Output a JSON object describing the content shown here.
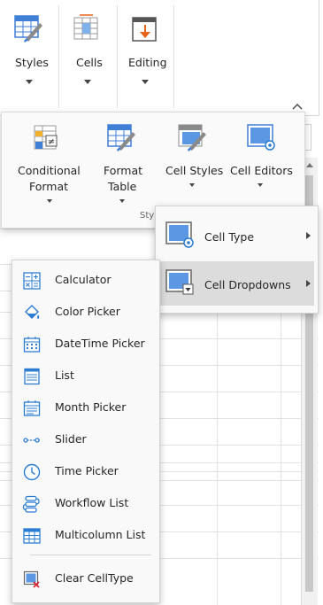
{
  "ribbon": {
    "groups": [
      {
        "label": "Styles",
        "icon": "styles-icon"
      },
      {
        "label": "Cells",
        "icon": "cells-icon"
      },
      {
        "label": "Editing",
        "icon": "editing-icon"
      }
    ],
    "collapse_icon": "chevron-up-icon"
  },
  "styles_popup": {
    "buttons": [
      {
        "line1": "Conditional",
        "line2": "Format",
        "icon": "conditional-format-icon"
      },
      {
        "line1": "Format",
        "line2": "Table",
        "icon": "format-table-icon"
      },
      {
        "line1": "Cell Styles",
        "line2": "",
        "icon": "cell-styles-icon"
      },
      {
        "line1": "Cell Editors",
        "line2": "",
        "icon": "cell-editors-icon"
      }
    ],
    "group_label": "Sty"
  },
  "cell_editors_menu": {
    "items": [
      {
        "label": "Cell Type",
        "icon": "cell-type-icon"
      },
      {
        "label": "Cell Dropdowns",
        "icon": "cell-dropdowns-icon"
      }
    ]
  },
  "dropdowns_menu": {
    "items": [
      {
        "label": "Calculator",
        "icon": "calculator-icon"
      },
      {
        "label": "Color Picker",
        "icon": "color-picker-icon"
      },
      {
        "label": "DateTime Picker",
        "icon": "datetime-picker-icon"
      },
      {
        "label": "List",
        "icon": "list-icon"
      },
      {
        "label": "Month Picker",
        "icon": "month-picker-icon"
      },
      {
        "label": "Slider",
        "icon": "slider-icon"
      },
      {
        "label": "Time Picker",
        "icon": "time-picker-icon"
      },
      {
        "label": "Workflow List",
        "icon": "workflow-list-icon"
      },
      {
        "label": "Multicolumn List",
        "icon": "multicolumn-list-icon"
      }
    ],
    "clear_label": "Clear CellType",
    "clear_icon": "clear-celltype-icon"
  },
  "colors": {
    "accent": "#2b7cd3",
    "icon_blue": "#3f7fd6",
    "highlight": "#dcdcdc",
    "menu_bg": "#f9f9f9",
    "editing_orange": "#e8631a"
  }
}
